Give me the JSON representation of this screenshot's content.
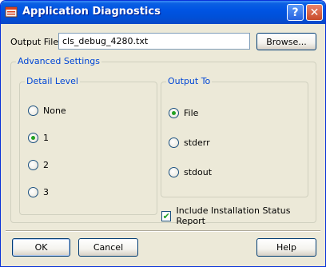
{
  "window": {
    "title": "Application Diagnostics",
    "help_glyph": "?",
    "close_glyph": "✕",
    "icon": "app-window-icon"
  },
  "output_file": {
    "label": "Output File",
    "value": "cls_debug_4280.txt",
    "browse_label": "Browse..."
  },
  "advanced": {
    "title": "Advanced Settings",
    "detail_level": {
      "title": "Detail Level",
      "options": [
        "None",
        "1",
        "2",
        "3"
      ],
      "selected": "1"
    },
    "output_to": {
      "title": "Output To",
      "options": [
        "File",
        "stderr",
        "stdout"
      ],
      "selected": "File"
    },
    "include_report": {
      "label": "Include Installation Status Report",
      "checked": true
    }
  },
  "footer": {
    "ok_label": "OK",
    "cancel_label": "Cancel",
    "help_label": "Help"
  },
  "colors": {
    "title_bar": "#0054e3",
    "group_title": "#0046d5",
    "selected_radio": "#21a121",
    "dialog_bg": "#ece9d8"
  }
}
